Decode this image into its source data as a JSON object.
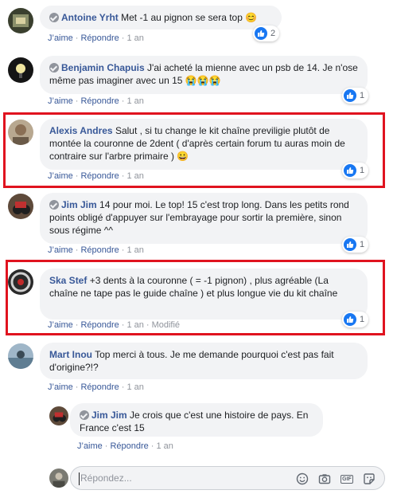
{
  "colors": {
    "link": "#385898",
    "bubble": "#f2f3f5",
    "like": "#1877f2",
    "highlight": "#e0131f",
    "meta": "#90949c"
  },
  "comments": [
    {
      "author": "Antoine Yrht",
      "text": "Met -1 au pignon se sera top 😊",
      "like": "J’aime",
      "reply": "Répondre",
      "time": "1 an",
      "reactions": "2"
    },
    {
      "author": "Benjamin Chapuis",
      "text": "J'ai acheté la mienne avec un psb de 14. Je n'ose même pas imaginer avec un 15 😭😭😭",
      "like": "J’aime",
      "reply": "Répondre",
      "time": "1 an",
      "reactions": "1"
    },
    {
      "author": "Alexis Andres",
      "text": "Salut , si tu change le kit chaîne previligie plutôt de montée la couronne de 2dent ( d'après certain forum tu auras moin de contraire sur l'arbre primaire ) 😀",
      "like": "J’aime",
      "reply": "Répondre",
      "time": "1 an",
      "reactions": "1"
    },
    {
      "author": "Jim Jim",
      "text": "14 pour moi. Le top! 15 c'est trop long. Dans les petits rond points obligé d'appuyer sur l'embrayage pour sortir la première, sinon sous régime ^^",
      "like": "J’aime",
      "reply": "Répondre",
      "time": "1 an",
      "reactions": "1"
    },
    {
      "author": "Ska Stef",
      "text": "+3 dents à la couronne ( = -1 pignon) , plus agréable (La chaîne ne tape pas le guide chaîne ) et plus longue vie du kit chaîne",
      "like": "J’aime",
      "reply": "Répondre",
      "time": "1 an",
      "edited": "Modifié",
      "reactions": "1"
    },
    {
      "author": "Mart Inou",
      "text": "Top merci à tous. Je me demande pourquoi c'est pas fait d'origine?!?",
      "like": "J’aime",
      "reply": "Répondre",
      "time": "1 an"
    },
    {
      "author": "Jim Jim",
      "text": "Je crois que c'est une histoire de pays. En France c'est 15",
      "like": "J’aime",
      "reply": "Répondre",
      "time": "1 an"
    }
  ],
  "composer": {
    "placeholder": "Répondez...",
    "icons": [
      "smiley-icon",
      "camera-icon",
      "gif-icon",
      "sticker-icon"
    ]
  }
}
